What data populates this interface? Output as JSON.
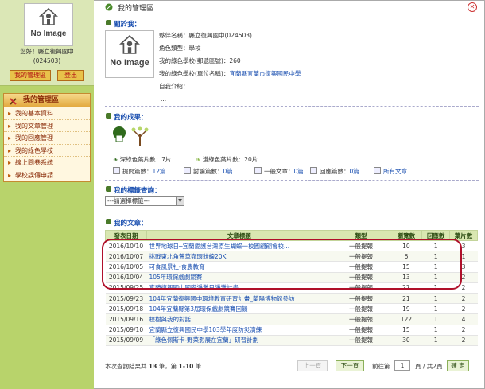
{
  "sidebar": {
    "avatar_caption": "No Image",
    "greeting_line1": "您好！縣立復興國中",
    "greeting_line2": "(024503)",
    "btn_my_area": "我的管理區",
    "btn_logout": "登出",
    "menu_title": "我的管理區",
    "menu_items": [
      "我的基本資料",
      "我的文章管理",
      "我的回應管理",
      "我的綠色學校",
      "線上問卷系統",
      "學校誤傳申請"
    ]
  },
  "header": {
    "title": "我的管理區"
  },
  "about": {
    "section_title": "關於我：",
    "avatar_caption": "No Image",
    "name_label": "夥伴名稱：",
    "name_value": "縣立復興國中(024503)",
    "role_label": "角色類型：",
    "role_value": "學校",
    "postal_label": "我的綠色學校(郵遞區號)：",
    "postal_value": "260",
    "unit_label": "我的綠色學校(單位名稱)：",
    "unit_value": "宜蘭縣宜蘭市復興國民中學",
    "intro_label": "自我介紹：",
    "intro_value": "..."
  },
  "achievements": {
    "section_title": "我的成果：",
    "deep_leaf_label": "深綠色葉片數：",
    "deep_leaf_value": "7片",
    "light_leaf_label": "淺綠色葉片數：",
    "light_leaf_value": "20片",
    "stats": [
      {
        "label": "提問篇數：",
        "value": "12篇"
      },
      {
        "label": "討論篇數：",
        "value": "0篇"
      },
      {
        "label": "一般文章：",
        "value": "0篇"
      },
      {
        "label": "回應篇數：",
        "value": "0篇"
      }
    ],
    "all_articles": "所有文章"
  },
  "tags": {
    "section_title": "我的標籤查詢：",
    "select_value": "---請選擇標籤---"
  },
  "articles": {
    "section_title": "我的文章：",
    "headers": [
      "發表日期",
      "文章標題",
      "類型",
      "瀏覽數",
      "回應數",
      "葉片數"
    ],
    "rows": [
      [
        "2016/10/10",
        "世界地球日─宜蘭愛護台灣原生蝴蝶一校園翩翩會校...",
        "一般提報",
        "10",
        "1",
        "3"
      ],
      [
        "2016/10/07",
        "挑戰東北角舊草嶺環狀線20K",
        "一般提報",
        "6",
        "1",
        "1"
      ],
      [
        "2016/10/05",
        "可食風景社-食農教育",
        "一般提報",
        "15",
        "1",
        "3"
      ],
      [
        "2016/10/04",
        "105年環保戲劇競賽",
        "一般提報",
        "13",
        "1",
        "2"
      ],
      [
        "2015/09/25",
        "宜蘭復興國中國際淨灘日淨灘計畫",
        "一般提報",
        "27",
        "1",
        "2"
      ],
      [
        "2015/09/23",
        "104年宜蘭復興國中環境教育研習計畫_蘭陽博物館參訪",
        "一般提報",
        "21",
        "1",
        "2"
      ],
      [
        "2015/09/18",
        "104年宜蘭縣第3屆環保戲劇競賽回饋",
        "一般提報",
        "19",
        "1",
        "2"
      ],
      [
        "2015/09/16",
        "校樹與我的對話",
        "一般提報",
        "122",
        "1",
        "4"
      ],
      [
        "2015/09/10",
        "宜蘭縣立復興國民中學103學年度防災演練",
        "一般提報",
        "15",
        "1",
        "2"
      ],
      [
        "2015/09/09",
        "「綠色佩斯卡-野菜影展在宜蘭」研習計劃",
        "一般提報",
        "30",
        "1",
        "2"
      ]
    ],
    "summary_prefix": "本次查詢結果共",
    "summary_count": "13",
    "summary_mid": "筆，第",
    "summary_range": "1-10",
    "summary_suffix": "筆",
    "prev_btn": "上一頁",
    "next_btn": "下一頁",
    "page_prefix": "前往第",
    "page_value": "1",
    "page_suffix": "頁 / 共2頁",
    "go_btn": "確 定"
  }
}
